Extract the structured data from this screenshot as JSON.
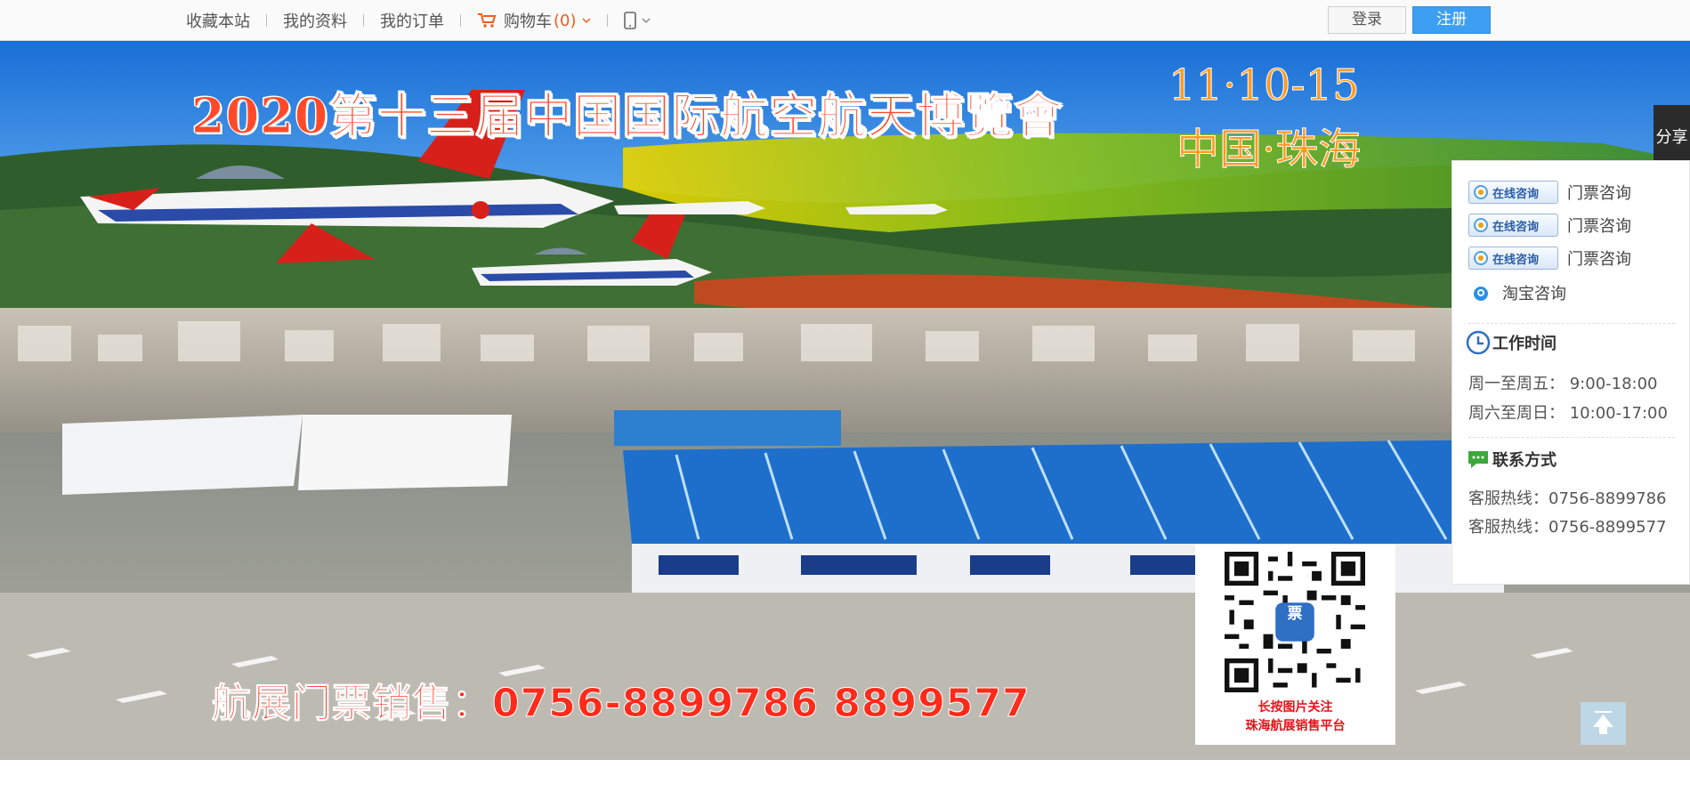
{
  "topbar": {
    "links": [
      "收藏本站",
      "我的资料",
      "我的订单"
    ],
    "cart_label": "购物车",
    "cart_count": "(0)",
    "login_label": "登录",
    "register_label": "注册"
  },
  "banner": {
    "title": "2020第十三届中国国际航空航天博覽會",
    "dates": "11·10-15",
    "place": "中国·珠海",
    "sales_line": "航展门票销售：0756-8899786  8899577"
  },
  "qr": {
    "center_glyph": "票",
    "caption_line1": "长按图片关注",
    "caption_line2": "珠海航展销售平台"
  },
  "share": {
    "label": "分享"
  },
  "side": {
    "consult_badge": "在线咨询",
    "consult_items": [
      "门票咨询",
      "门票咨询",
      "门票咨询"
    ],
    "taobao_label": "淘宝咨询",
    "work_title": "工作时间",
    "work_hours": [
      "周一至周五： 9:00-18:00",
      "周六至周日： 10:00-17:00"
    ],
    "contact_title": "联系方式",
    "hotlines": [
      "客服热线：0756-8899786",
      "客服热线：0756-8899577"
    ]
  },
  "colors": {
    "accent": "#3d9ff2",
    "cart_count": "#f25a1f",
    "banner_title": "#ff4a2a",
    "qr_caption": "#e4141b"
  }
}
